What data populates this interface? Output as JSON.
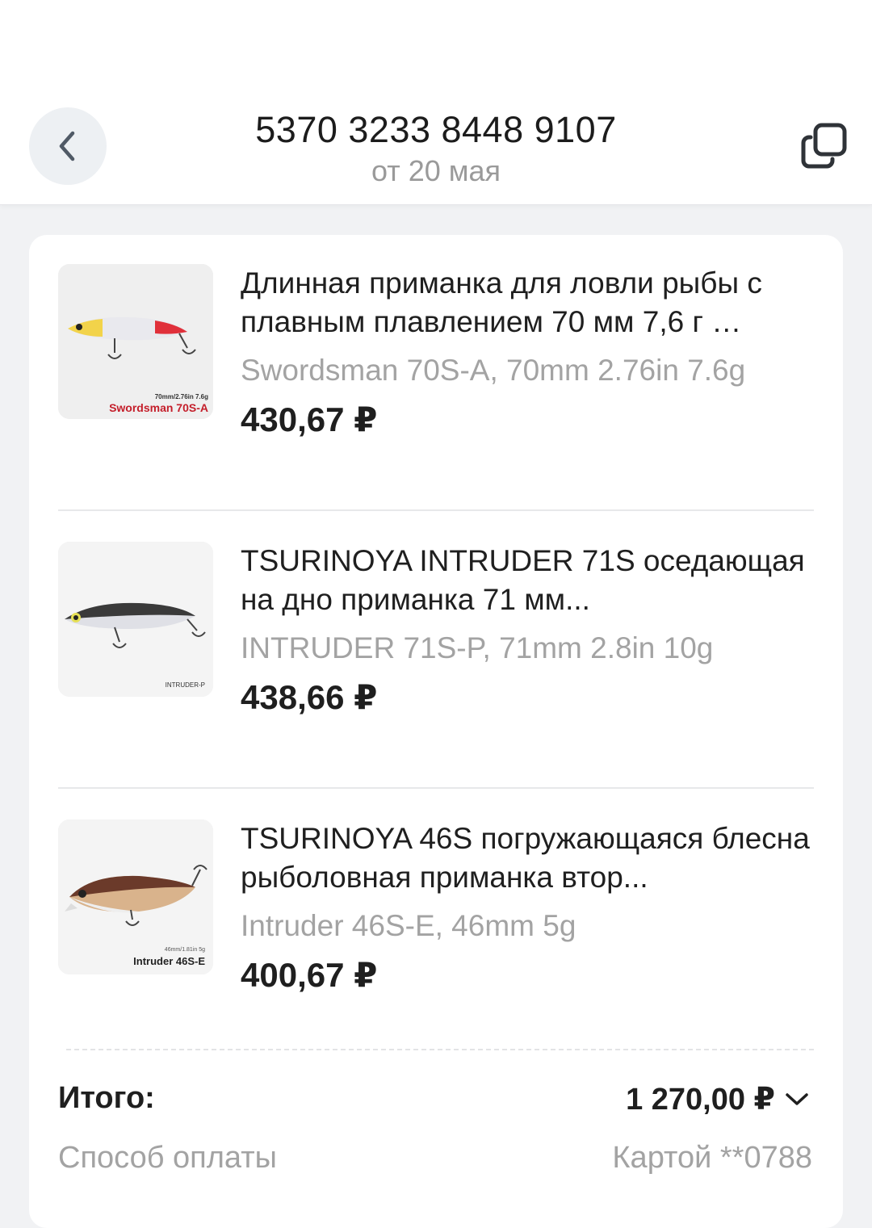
{
  "header": {
    "order_number": "5370 3233 8448 9107",
    "order_date": "от 20 мая",
    "back_icon": "chevron-left-icon",
    "copy_icon": "copy-icon"
  },
  "items": [
    {
      "title": "Длинная приманка для ловли рыбы с плавным плавлением 70 мм 7,6 г …",
      "variant": "Swordsman 70S-A, 70mm 2.76in 7.6g",
      "price": "430,67 ₽",
      "thumb_caption_small": "70mm/2.76in 7.6g",
      "thumb_caption": "Swordsman 70S-A"
    },
    {
      "title": "TSURINOYA INTRUDER 71S оседающая на дно приманка 71 мм...",
      "variant": "INTRUDER 71S-P, 71mm 2.8in 10g",
      "price": "438,66 ₽",
      "thumb_caption_small": "",
      "thumb_caption": "INTRUDER-P"
    },
    {
      "title": "TSURINOYA 46S погружающаяся блесна рыболовная приманка втор...",
      "variant": "Intruder 46S-E, 46mm 5g",
      "price": "400,67 ₽",
      "thumb_caption_small": "46mm/1.81in 5g",
      "thumb_caption": "Intruder 46S-E"
    }
  ],
  "summary": {
    "total_label": "Итого:",
    "total_value": "1 270,00 ₽",
    "payment_label": "Способ оплаты",
    "payment_value": "Картой **0788"
  },
  "colors": {
    "background": "#f1f2f4",
    "card": "#ffffff",
    "secondary_text": "#a3a3a3",
    "primary_text": "#1f1f1f"
  }
}
